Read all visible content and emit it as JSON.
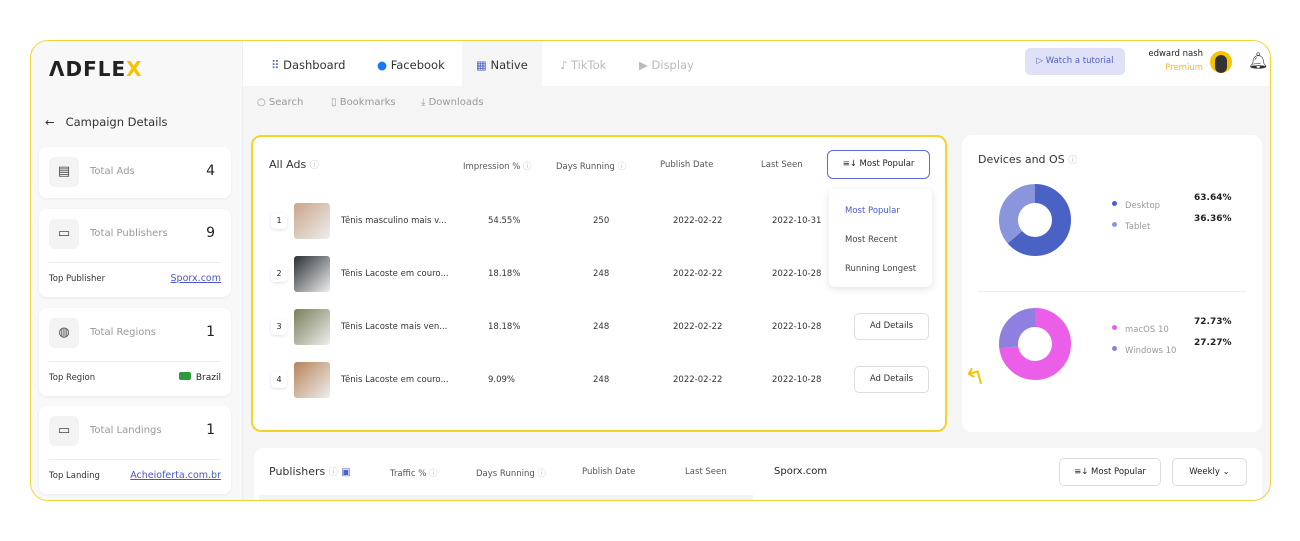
{
  "brand": {
    "logo": "ADFLEX"
  },
  "sidebar": {
    "back_label": "Campaign Details",
    "cards": [
      {
        "label": "Total Ads",
        "value": "4",
        "icon": "ads-icon"
      },
      {
        "label": "Total Publishers",
        "value": "9",
        "icon": "publisher-icon",
        "footer_label": "Top Publisher",
        "footer_value": "Sporx.com"
      },
      {
        "label": "Total Regions",
        "value": "1",
        "icon": "globe-icon",
        "footer_label": "Top Region",
        "footer_value": "Brazil"
      },
      {
        "label": "Total Landings",
        "value": "1",
        "icon": "monitor-icon",
        "footer_label": "Top Landing",
        "footer_value": "Acheioferta.com.br"
      }
    ]
  },
  "tabs": [
    {
      "label": "Dashboard",
      "icon": "grid-icon"
    },
    {
      "label": "Facebook",
      "icon": "facebook-icon"
    },
    {
      "label": "Native",
      "icon": "native-icon",
      "active": true
    },
    {
      "label": "TikTok",
      "icon": "tiktok-icon",
      "disabled": true
    },
    {
      "label": "Display",
      "icon": "play-icon",
      "disabled": true
    }
  ],
  "subnav": [
    {
      "label": "Search",
      "icon": "search-icon"
    },
    {
      "label": "Bookmarks",
      "icon": "bookmark-icon"
    },
    {
      "label": "Downloads",
      "icon": "download-icon"
    }
  ],
  "header": {
    "tutorial": "Watch a tutorial",
    "user_name": "edward nash",
    "user_plan": "Premium"
  },
  "ads": {
    "title": "All Ads",
    "columns": [
      "Impression %",
      "Days Running",
      "Publish Date",
      "Last Seen"
    ],
    "sort": "Most Popular",
    "sort_options": [
      "Most Popular",
      "Most Recent",
      "Running Longest"
    ],
    "details_label": "Ad Details",
    "rows": [
      {
        "n": "1",
        "title": "Tênis masculino mais v...",
        "impression": "54.55%",
        "days": "250",
        "publish": "2022-02-22",
        "last": "2022-10-31",
        "color": "#c9a58a"
      },
      {
        "n": "2",
        "title": "Tênis Lacoste em couro...",
        "impression": "18.18%",
        "days": "248",
        "publish": "2022-02-22",
        "last": "2022-10-28",
        "color": "#2b2f33"
      },
      {
        "n": "3",
        "title": "Tênis Lacoste mais ven...",
        "impression": "18.18%",
        "days": "248",
        "publish": "2022-02-22",
        "last": "2022-10-28",
        "color": "#7a7f5a"
      },
      {
        "n": "4",
        "title": "Tênis Lacoste em couro...",
        "impression": "9.09%",
        "days": "248",
        "publish": "2022-02-22",
        "last": "2022-10-28",
        "color": "#b78358"
      }
    ]
  },
  "devices": {
    "title": "Devices and OS",
    "charts": [
      [
        {
          "name": "Desktop",
          "value": "63.64%",
          "pct": 63.64,
          "color": "#4a62c4"
        },
        {
          "name": "Tablet",
          "value": "36.36%",
          "pct": 36.36,
          "color": "#8a96dc"
        }
      ],
      [
        {
          "name": "macOS 10",
          "value": "72.73%",
          "pct": 72.73,
          "color": "#ea5ee8"
        },
        {
          "name": "Windows 10",
          "value": "27.27%",
          "pct": 27.27,
          "color": "#8e7fe0"
        }
      ]
    ]
  },
  "publishers": {
    "title": "Publishers",
    "columns": [
      "Traffic %",
      "Days Running",
      "Publish Date",
      "Last Seen"
    ],
    "selected": "Sporx.com",
    "sort": "Most Popular",
    "period": "Weekly"
  }
}
